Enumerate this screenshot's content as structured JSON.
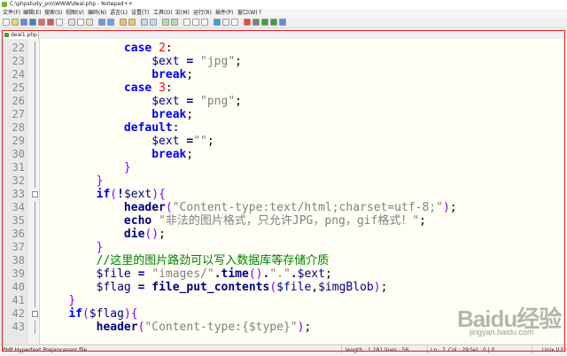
{
  "window": {
    "title": "C:\\phpstudy_pro\\WWW\\deal.php - Notepad++"
  },
  "menu": [
    "文件(F)",
    "编辑(E)",
    "搜索(S)",
    "视图(V)",
    "编码(N)",
    "语言(L)",
    "设置(T)",
    "工具(O)",
    "宏(M)",
    "运行(R)",
    "插件(P)",
    "窗口(W)",
    "?"
  ],
  "tabs": [
    {
      "label": "deal1.php"
    }
  ],
  "editor": {
    "lines": [
      {
        "num": "22",
        "tokens": [
          [
            "pl",
            "            "
          ],
          [
            "kw",
            "case"
          ],
          [
            "pl",
            " "
          ],
          [
            "num",
            "2"
          ],
          [
            "pl",
            ":"
          ]
        ]
      },
      {
        "num": "23",
        "tokens": [
          [
            "pl",
            "                "
          ],
          [
            "var",
            "$ext"
          ],
          [
            "pl",
            " "
          ],
          [
            "op",
            "="
          ],
          [
            "pl",
            " "
          ],
          [
            "str",
            "\"jpg\""
          ],
          [
            "pl",
            ";"
          ]
        ]
      },
      {
        "num": "24",
        "tokens": [
          [
            "pl",
            "                "
          ],
          [
            "kw",
            "break"
          ],
          [
            "pl",
            ";"
          ]
        ]
      },
      {
        "num": "25",
        "tokens": [
          [
            "pl",
            "            "
          ],
          [
            "kw",
            "case"
          ],
          [
            "pl",
            " "
          ],
          [
            "num",
            "3"
          ],
          [
            "pl",
            ":"
          ]
        ]
      },
      {
        "num": "26",
        "tokens": [
          [
            "pl",
            "                "
          ],
          [
            "var",
            "$ext"
          ],
          [
            "pl",
            " "
          ],
          [
            "op",
            "="
          ],
          [
            "pl",
            " "
          ],
          [
            "str",
            "\"png\""
          ],
          [
            "pl",
            ";"
          ]
        ]
      },
      {
        "num": "27",
        "tokens": [
          [
            "pl",
            "                "
          ],
          [
            "kw",
            "break"
          ],
          [
            "pl",
            ";"
          ]
        ]
      },
      {
        "num": "28",
        "tokens": [
          [
            "pl",
            "            "
          ],
          [
            "kw",
            "default"
          ],
          [
            "pl",
            ":"
          ]
        ]
      },
      {
        "num": "29",
        "tokens": [
          [
            "pl",
            "                "
          ],
          [
            "var",
            "$ext"
          ],
          [
            "pl",
            " "
          ],
          [
            "op",
            "="
          ],
          [
            "str",
            "\"\""
          ],
          [
            "pl",
            ";"
          ]
        ]
      },
      {
        "num": "30",
        "tokens": [
          [
            "pl",
            "                "
          ],
          [
            "kw",
            "break"
          ],
          [
            "pl",
            ";"
          ]
        ]
      },
      {
        "num": "31",
        "tokens": [
          [
            "pl",
            "            "
          ],
          [
            "br",
            "}"
          ]
        ]
      },
      {
        "num": "32",
        "tokens": [
          [
            "pl",
            "        "
          ],
          [
            "br",
            "}"
          ]
        ]
      },
      {
        "num": "33",
        "tokens": [
          [
            "pl",
            "        "
          ],
          [
            "kw",
            "if"
          ],
          [
            "br",
            "("
          ],
          [
            "op",
            "!"
          ],
          [
            "var",
            "$ext"
          ],
          [
            "br",
            ")"
          ],
          [
            "br",
            "{"
          ]
        ]
      },
      {
        "num": "34",
        "tokens": [
          [
            "pl",
            "            "
          ],
          [
            "fn",
            "header"
          ],
          [
            "br",
            "("
          ],
          [
            "str",
            "\"Content-type:text/html;charset=utf-8;\""
          ],
          [
            "br",
            ")"
          ],
          [
            "pl",
            ";"
          ]
        ]
      },
      {
        "num": "35",
        "tokens": [
          [
            "pl",
            "            "
          ],
          [
            "fn",
            "echo"
          ],
          [
            "pl",
            " "
          ],
          [
            "str",
            "\"非法的图片格式，只允许JPG，png，gif格式！\""
          ],
          [
            "pl",
            ";"
          ]
        ]
      },
      {
        "num": "36",
        "tokens": [
          [
            "pl",
            "            "
          ],
          [
            "fn",
            "die"
          ],
          [
            "br",
            "()"
          ],
          [
            "pl",
            ";"
          ]
        ]
      },
      {
        "num": "37",
        "tokens": [
          [
            "pl",
            "        "
          ],
          [
            "br",
            "}"
          ]
        ]
      },
      {
        "num": "38",
        "tokens": [
          [
            "pl",
            "        "
          ],
          [
            "cm",
            "//这里的图片路劲可以写入数据库等存储介质"
          ]
        ]
      },
      {
        "num": "39",
        "tokens": [
          [
            "pl",
            "        "
          ],
          [
            "var",
            "$file"
          ],
          [
            "pl",
            " "
          ],
          [
            "op",
            "="
          ],
          [
            "pl",
            " "
          ],
          [
            "str",
            "\"images/\""
          ],
          [
            "op",
            "."
          ],
          [
            "fn",
            "time"
          ],
          [
            "br",
            "()"
          ],
          [
            "op",
            "."
          ],
          [
            "str",
            "\".\""
          ],
          [
            "op",
            "."
          ],
          [
            "var",
            "$ext"
          ],
          [
            "pl",
            ";"
          ]
        ]
      },
      {
        "num": "40",
        "tokens": [
          [
            "pl",
            "        "
          ],
          [
            "var",
            "$flag"
          ],
          [
            "pl",
            " "
          ],
          [
            "op",
            "="
          ],
          [
            "pl",
            " "
          ],
          [
            "fn",
            "file_put_contents"
          ],
          [
            "br",
            "("
          ],
          [
            "var",
            "$file"
          ],
          [
            "pl",
            ","
          ],
          [
            "var",
            "$imgBlob"
          ],
          [
            "br",
            ")"
          ],
          [
            "pl",
            ";"
          ]
        ]
      },
      {
        "num": "41",
        "tokens": [
          [
            "pl",
            "    "
          ],
          [
            "br",
            "}"
          ]
        ]
      },
      {
        "num": "42",
        "tokens": [
          [
            "pl",
            "    "
          ],
          [
            "kw",
            "if"
          ],
          [
            "br",
            "("
          ],
          [
            "var",
            "$flag"
          ],
          [
            "br",
            ")"
          ],
          [
            "br",
            "{"
          ]
        ]
      },
      {
        "num": "43",
        "tokens": [
          [
            "pl",
            "        "
          ],
          [
            "fn",
            "header"
          ],
          [
            "br",
            "("
          ],
          [
            "str",
            "\"Content-type:{$type}\""
          ],
          [
            "br",
            ")"
          ],
          [
            "pl",
            ";"
          ]
        ]
      }
    ]
  },
  "status": {
    "language": "PHP Hypertext Preprocessor file",
    "length": "length : 1,281",
    "lines": "lines : 56",
    "ln": "Ln : 7",
    "col": "Col : 29",
    "sel": "Sel : 0 | 0",
    "eol": "Unix (LF)"
  },
  "watermark": {
    "logo": "Baidu经验",
    "url": "jingyan.baidu.com"
  },
  "colors": {
    "keyword": "#0000ff",
    "function": "#000080",
    "number": "#ff0000",
    "string": "#808080",
    "comment": "#008000",
    "bracket": "#8000ff",
    "highlight_frame": "#e02020",
    "editor_bg": "#fffef4"
  }
}
